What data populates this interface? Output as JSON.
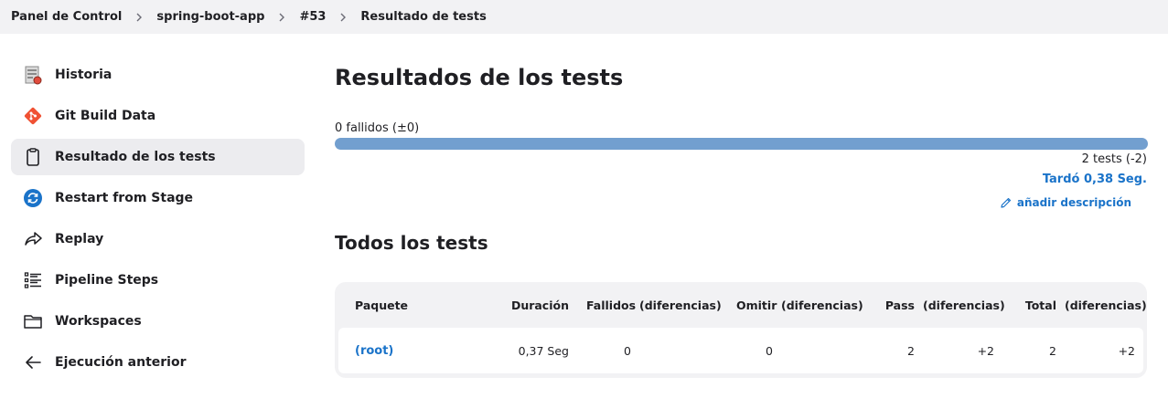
{
  "breadcrumb": {
    "items": [
      "Panel de Control",
      "spring-boot-app",
      "#53",
      "Resultado de tests"
    ]
  },
  "sidebar": {
    "items": [
      {
        "label": "Historia",
        "icon": "history-icon"
      },
      {
        "label": "Git Build Data",
        "icon": "git-icon"
      },
      {
        "label": "Resultado de los tests",
        "icon": "clipboard-icon"
      },
      {
        "label": "Restart from Stage",
        "icon": "restart-icon"
      },
      {
        "label": "Replay",
        "icon": "replay-icon"
      },
      {
        "label": "Pipeline Steps",
        "icon": "list-icon"
      },
      {
        "label": "Workspaces",
        "icon": "folder-icon"
      },
      {
        "label": "Ejecución anterior",
        "icon": "arrow-left-icon"
      }
    ],
    "active_index": 2
  },
  "main": {
    "title": "Resultados de los tests",
    "failed_label": "0 fallidos (±0)",
    "pass_fraction": 1.0,
    "tests_count": "2 tests (-2)",
    "duration": "Tardó 0,38 Seg.",
    "add_description": "añadir descripción",
    "section_title": "Todos los tests"
  },
  "table": {
    "headers": {
      "package": "Paquete",
      "duration": "Duración",
      "failed": "Fallidos",
      "failed_diff": "(diferencias)",
      "skipped": "Omitir",
      "skipped_diff": "(diferencias)",
      "pass": "Pass",
      "pass_diff": "(diferencias)",
      "total": "Total",
      "total_diff": "(diferencias)"
    },
    "rows": [
      {
        "package": "(root)",
        "duration": "0,37 Seg",
        "failed": "0",
        "failed_diff": "",
        "skipped": "0",
        "skipped_diff": "",
        "pass": "2",
        "pass_diff": "+2",
        "total": "2",
        "total_diff": "+2"
      }
    ]
  },
  "colors": {
    "accent": "#1a73c9",
    "bar": "#729fcf",
    "git": "#f05133",
    "restart": "#1a73c9"
  }
}
